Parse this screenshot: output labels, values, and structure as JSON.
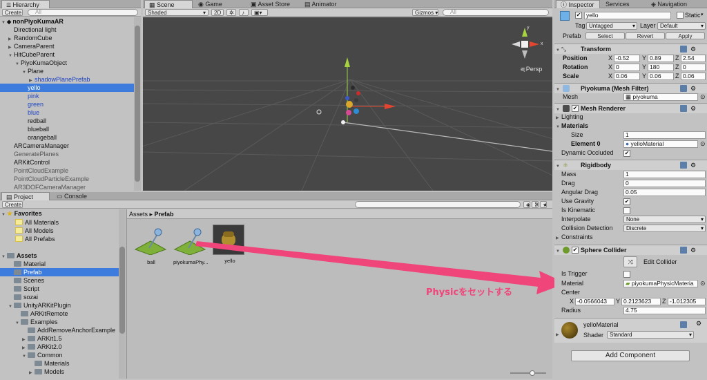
{
  "hierarchy": {
    "tab": "Hierarchy",
    "create": "Create",
    "search_placeholder": "All",
    "scene": "nonPiyoKumaAR",
    "items": [
      {
        "label": "Directional light",
        "indent": 1,
        "tri": ""
      },
      {
        "label": "RandomCube",
        "indent": 1,
        "tri": "▶"
      },
      {
        "label": "CameraParent",
        "indent": 1,
        "tri": "▶"
      },
      {
        "label": "HitCubeParent",
        "indent": 1,
        "tri": "▼"
      },
      {
        "label": "PiyoKumaObject",
        "indent": 2,
        "tri": "▼"
      },
      {
        "label": "Plane",
        "indent": 3,
        "tri": "▼"
      },
      {
        "label": "shadowPlanePrefab",
        "indent": 4,
        "tri": "▶",
        "blue": true
      },
      {
        "label": "yello",
        "indent": 3,
        "tri": "",
        "selected": true
      },
      {
        "label": "pink",
        "indent": 3,
        "tri": "",
        "blue": true
      },
      {
        "label": "green",
        "indent": 3,
        "tri": "",
        "blue": true
      },
      {
        "label": "blue",
        "indent": 3,
        "tri": "",
        "blue": true
      },
      {
        "label": "redball",
        "indent": 3,
        "tri": ""
      },
      {
        "label": "blueball",
        "indent": 3,
        "tri": ""
      },
      {
        "label": "orangeball",
        "indent": 3,
        "tri": ""
      },
      {
        "label": "ARCameraManager",
        "indent": 1,
        "tri": ""
      },
      {
        "label": "GeneratePlanes",
        "indent": 1,
        "tri": "",
        "grey": true
      },
      {
        "label": "ARKitControl",
        "indent": 1,
        "tri": ""
      },
      {
        "label": "PointCloudExample",
        "indent": 1,
        "tri": "",
        "grey": true
      },
      {
        "label": "PointCloudParticleExample",
        "indent": 1,
        "tri": "",
        "grey": true
      },
      {
        "label": "AR3DOFCameraManager",
        "indent": 1,
        "tri": "",
        "grey": true
      }
    ]
  },
  "scene_view": {
    "tabs": [
      "Scene",
      "Game",
      "Asset Store",
      "Animator"
    ],
    "shading": "Shaded",
    "mode_2d": "2D",
    "gizmos": "Gizmos",
    "search_placeholder": "All",
    "persp": "Persp"
  },
  "project": {
    "tabs": [
      "Project",
      "Console"
    ],
    "create": "Create",
    "favorites": {
      "label": "Favorites",
      "items": [
        "All Materials",
        "All Models",
        "All Prefabs"
      ]
    },
    "assets_tree": [
      {
        "label": "Assets",
        "indent": 0,
        "tri": "▼",
        "bold": true
      },
      {
        "label": "Material",
        "indent": 1,
        "tri": ""
      },
      {
        "label": "Prefab",
        "indent": 1,
        "tri": "",
        "selected": true
      },
      {
        "label": "Scenes",
        "indent": 1,
        "tri": ""
      },
      {
        "label": "Script",
        "indent": 1,
        "tri": ""
      },
      {
        "label": "sozai",
        "indent": 1,
        "tri": ""
      },
      {
        "label": "UnityARKitPlugin",
        "indent": 1,
        "tri": "▼"
      },
      {
        "label": "ARKitRemote",
        "indent": 2,
        "tri": ""
      },
      {
        "label": "Examples",
        "indent": 2,
        "tri": "▼"
      },
      {
        "label": "AddRemoveAnchorExample",
        "indent": 3,
        "tri": ""
      },
      {
        "label": "ARKit1.5",
        "indent": 3,
        "tri": "▶"
      },
      {
        "label": "ARKit2.0",
        "indent": 3,
        "tri": "▶"
      },
      {
        "label": "Common",
        "indent": 3,
        "tri": "▼"
      },
      {
        "label": "Materials",
        "indent": 4,
        "tri": ""
      },
      {
        "label": "Models",
        "indent": 4,
        "tri": "▶"
      }
    ],
    "breadcrumb": [
      "Assets",
      "Prefab"
    ],
    "assets": [
      {
        "label": "ball",
        "kind": "plane"
      },
      {
        "label": "piyokumaPhy...",
        "kind": "plane"
      },
      {
        "label": "yello",
        "kind": "model"
      }
    ]
  },
  "annotation": {
    "text": "Physicをセットする",
    "color": "#f0457a"
  },
  "inspector": {
    "tabs": [
      "Inspector",
      "Services",
      "Navigation"
    ],
    "object_name": "yello",
    "static_label": "Static",
    "tag_label": "Tag",
    "tag_value": "Untagged",
    "layer_label": "Layer",
    "layer_value": "Default",
    "prefab_label": "Prefab",
    "prefab_select": "Select",
    "prefab_revert": "Revert",
    "prefab_apply": "Apply",
    "transform": {
      "title": "Transform",
      "position": {
        "label": "Position",
        "x": "-0.52",
        "y": "0.89",
        "z": "2.54"
      },
      "rotation": {
        "label": "Rotation",
        "x": "0",
        "y": "180",
        "z": "0"
      },
      "scale": {
        "label": "Scale",
        "x": "0.06",
        "y": "0.06",
        "z": "0.06"
      }
    },
    "mesh_filter": {
      "title": "Piyokuma (Mesh Filter)",
      "mesh_label": "Mesh",
      "mesh_value": "piyokuma"
    },
    "mesh_renderer": {
      "title": "Mesh Renderer",
      "lighting": "Lighting",
      "materials": "Materials",
      "size_label": "Size",
      "size_value": "1",
      "element_label": "Element 0",
      "element_value": "yelloMaterial",
      "dynamic_occluded": "Dynamic Occluded"
    },
    "rigidbody": {
      "title": "Rigidbody",
      "mass_label": "Mass",
      "mass": "1",
      "drag_label": "Drag",
      "drag": "0",
      "angular_label": "Angular Drag",
      "angular": "0.05",
      "gravity_label": "Use Gravity",
      "kinematic_label": "Is Kinematic",
      "interpolate_label": "Interpolate",
      "interpolate": "None",
      "collision_label": "Collision Detection",
      "collision": "Discrete",
      "constraints": "Constraints"
    },
    "sphere_collider": {
      "title": "Sphere Collider",
      "edit": "Edit Collider",
      "trigger_label": "Is Trigger",
      "material_label": "Material",
      "material": "piyokumaPhysicMateria",
      "center_label": "Center",
      "cx": "-0.0566043",
      "cy": "0.2123623",
      "cz": "-1.012305",
      "radius_label": "Radius",
      "radius": "4.75"
    },
    "material": {
      "name": "yelloMaterial",
      "shader_label": "Shader",
      "shader": "Standard"
    },
    "add_component": "Add Component"
  }
}
